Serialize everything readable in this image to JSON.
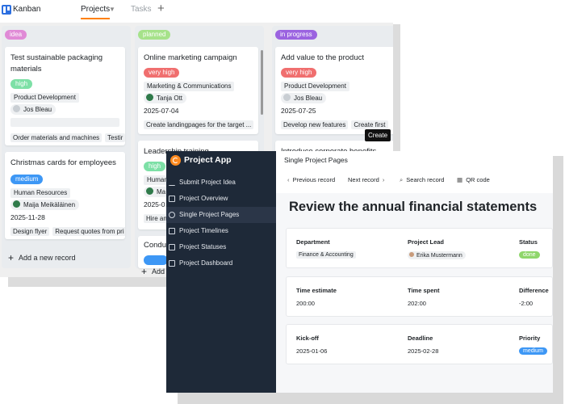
{
  "kanban": {
    "app_title": "Kanban",
    "tab_active": "Projects",
    "tab_inactive": "Tasks",
    "tooltip": "Create",
    "add_record": "Add a new record",
    "add_record_short": "Add",
    "columns": [
      {
        "label": "idea",
        "color": "#e08ad6",
        "cards": [
          {
            "title_line1": "Test sustainable packaging",
            "title_line2": "materials",
            "priority": "high",
            "priority_color": "#7de0a6",
            "department": "Product Development",
            "person": "Jos Bleau",
            "links": [
              "Order materials and machines",
              "Testir"
            ]
          },
          {
            "title_line1": "Christmas cards for employees",
            "priority": "medium",
            "priority_color": "#3d97f5",
            "department": "Human Resources",
            "person": "Maija Meikäläinen",
            "date": "2025-11-28",
            "links": [
              "Design flyer",
              "Request quotes from pri"
            ]
          }
        ]
      },
      {
        "label": "planned",
        "color": "#a6e28a",
        "cards": [
          {
            "title_line1": "Online marketing campaign",
            "priority": "very high",
            "priority_color": "#f06f6f",
            "department": "Marketing & Communications",
            "person": "Tanja Ott",
            "date": "2025-07-04",
            "links": [
              "Create landingpages for the target ..."
            ]
          },
          {
            "title_line1": "Leadership training",
            "priority": "high",
            "priority_color": "#7de0a6",
            "department": "Human",
            "person": "Ma",
            "date": "2025-0",
            "links": [
              "Hire an"
            ]
          },
          {
            "title_line1": "Condu"
          }
        ]
      },
      {
        "label": "in progress",
        "color": "#9b63e0",
        "cards": [
          {
            "title_line1": "Add value to the product",
            "priority": "very high",
            "priority_color": "#f06f6f",
            "department": "Product Development",
            "person": "Jos Bleau",
            "date": "2025-07-25",
            "links": [
              "Develop new features",
              "Create first"
            ]
          },
          {
            "title_line1": "Introduce corporate benefits"
          }
        ]
      }
    ]
  },
  "project_app": {
    "name": "Project App",
    "nav": [
      {
        "label": "Submit Project Idea",
        "icon": "pencil-icon",
        "active": false
      },
      {
        "label": "Project Overview",
        "icon": "table-icon",
        "active": false
      },
      {
        "label": "Single Project Pages",
        "icon": "info-icon",
        "active": true
      },
      {
        "label": "Project Timelines",
        "icon": "calendar-icon",
        "active": false
      },
      {
        "label": "Project Statuses",
        "icon": "status-icon",
        "active": false
      },
      {
        "label": "Project Dashboard",
        "icon": "dashboard-icon",
        "active": false
      }
    ],
    "page_title": "Single Project Pages",
    "toolbar": {
      "previous": "Previous record",
      "next": "Next record",
      "search": "Search record",
      "qr": "QR code"
    },
    "record_title": "Review the annual financial statements",
    "fields": {
      "department_label": "Department",
      "department_value": "Finance & Accounting",
      "lead_label": "Project Lead",
      "lead_value": "Erika Mustermann",
      "status_label": "Status",
      "status_value": "done",
      "status_color": "#8fd66b",
      "estimate_label": "Time estimate",
      "estimate_value": "200:00",
      "spent_label": "Time spent",
      "spent_value": "202:00",
      "difference_label": "Difference",
      "difference_value": "-2:00",
      "kickoff_label": "Kick-off",
      "kickoff_value": "2025-01-06",
      "deadline_label": "Deadline",
      "deadline_value": "2025-02-28",
      "priority_label": "Priority",
      "priority_value": "medium",
      "priority_color": "#3d97f5"
    }
  }
}
